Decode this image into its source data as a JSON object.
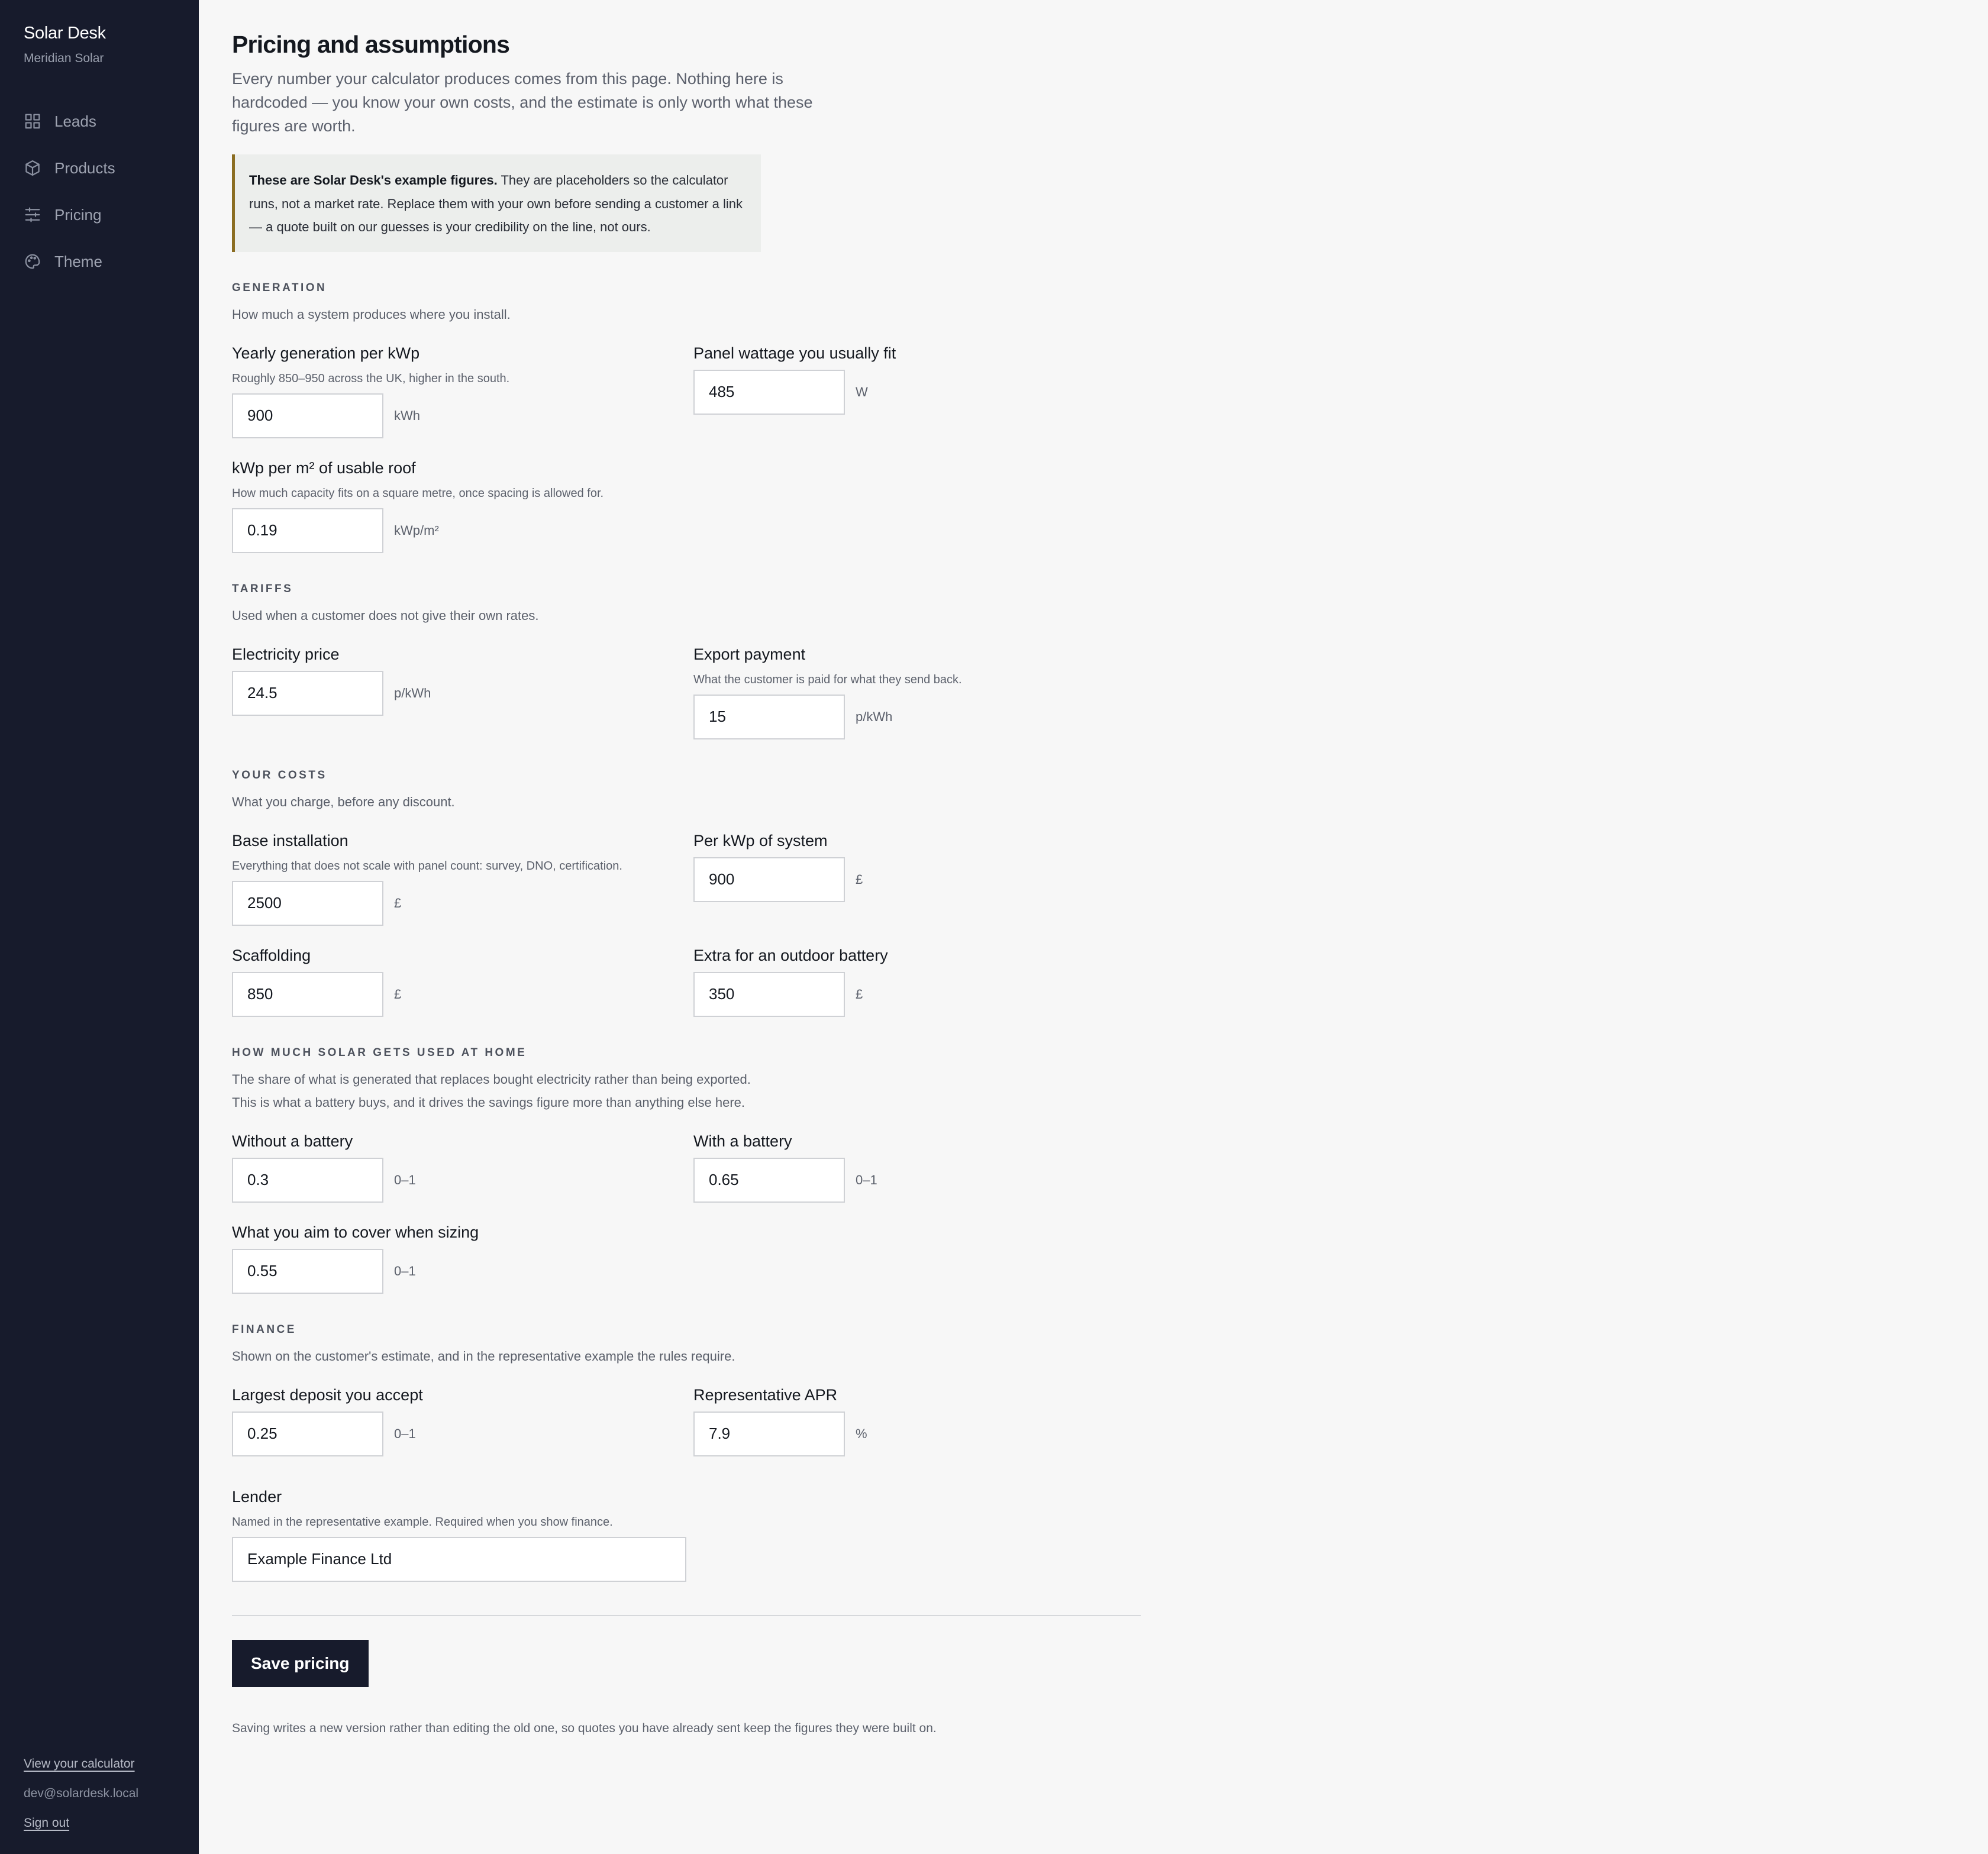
{
  "brand": {
    "name": "Solar Desk",
    "org": "Meridian Solar"
  },
  "nav": [
    {
      "label": "Leads",
      "icon": "grid-icon"
    },
    {
      "label": "Products",
      "icon": "box-icon"
    },
    {
      "label": "Pricing",
      "icon": "sliders-icon"
    },
    {
      "label": "Theme",
      "icon": "palette-icon"
    }
  ],
  "footer": {
    "view_calculator": "View your calculator",
    "email": "dev@solardesk.local",
    "sign_out": "Sign out"
  },
  "page": {
    "title": "Pricing and assumptions",
    "intro": "Every number your calculator produces comes from this page. Nothing here is hardcoded — you know your own costs, and the estimate is only worth what these figures are worth.",
    "notice_bold": "These are Solar Desk's example figures.",
    "notice_rest": " They are placeholders so the calculator runs, not a market rate. Replace them with your own before sending a customer a link — a quote built on our guesses is your credibility on the line, not ours."
  },
  "generation": {
    "heading": "GENERATION",
    "description": "How much a system produces where you install.",
    "yearly": {
      "label": "Yearly generation per kWp",
      "help": "Roughly 850–950 across the UK, higher in the south.",
      "value": "900",
      "unit": "kWh"
    },
    "wattage": {
      "label": "Panel wattage you usually fit",
      "value": "485",
      "unit": "W"
    },
    "density": {
      "label": "kWp per m² of usable roof",
      "help": "How much capacity fits on a square metre, once spacing is allowed for.",
      "value": "0.19",
      "unit": "kWp/m²"
    }
  },
  "tariffs": {
    "heading": "TARIFFS",
    "description": "Used when a customer does not give their own rates.",
    "electricity": {
      "label": "Electricity price",
      "value": "24.5",
      "unit": "p/kWh"
    },
    "export": {
      "label": "Export payment",
      "help": "What the customer is paid for what they send back.",
      "value": "15",
      "unit": "p/kWh"
    }
  },
  "costs": {
    "heading": "YOUR COSTS",
    "description": "What you charge, before any discount.",
    "base": {
      "label": "Base installation",
      "help": "Everything that does not scale with panel count: survey, DNO, certification.",
      "value": "2500",
      "unit": "£"
    },
    "per_kwp": {
      "label": "Per kWp of system",
      "value": "900",
      "unit": "£"
    },
    "scaffolding": {
      "label": "Scaffolding",
      "value": "850",
      "unit": "£"
    },
    "outdoor_battery": {
      "label": "Extra for an outdoor battery",
      "value": "350",
      "unit": "£"
    }
  },
  "usage": {
    "heading": "HOW MUCH SOLAR GETS USED AT HOME",
    "description": "The share of what is generated that replaces bought electricity rather than being exported. This is what a battery buys, and it drives the savings figure more than anything else here.",
    "without_battery": {
      "label": "Without a battery",
      "value": "0.3",
      "unit": "0–1"
    },
    "with_battery": {
      "label": "With a battery",
      "value": "0.65",
      "unit": "0–1"
    },
    "target": {
      "label": "What you aim to cover when sizing",
      "value": "0.55",
      "unit": "0–1"
    }
  },
  "finance": {
    "heading": "FINANCE",
    "description": "Shown on the customer's estimate, and in the representative example the rules require.",
    "deposit": {
      "label": "Largest deposit you accept",
      "value": "0.25",
      "unit": "0–1"
    },
    "apr": {
      "label": "Representative APR",
      "value": "7.9",
      "unit": "%"
    },
    "lender": {
      "label": "Lender",
      "help": "Named in the representative example. Required when you show finance.",
      "value": "Example Finance Ltd"
    }
  },
  "actions": {
    "save_label": "Save pricing",
    "save_note": "Saving writes a new version rather than editing the old one, so quotes you have already sent keep the figures they were built on."
  }
}
